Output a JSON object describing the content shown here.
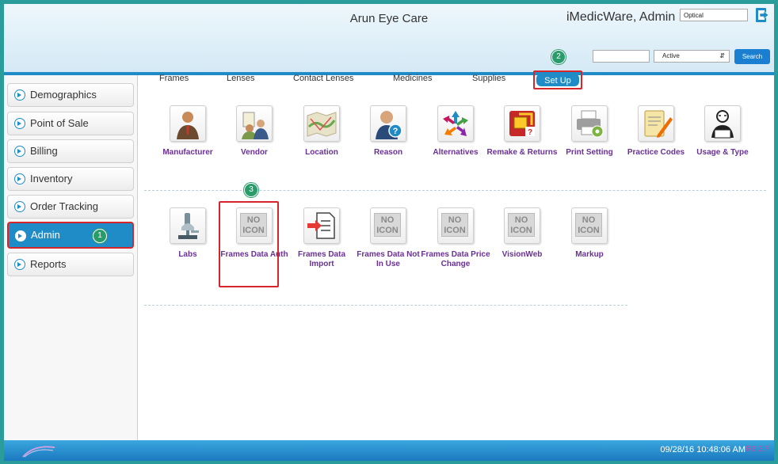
{
  "header": {
    "clinic": "Arun Eye Care",
    "user": "iMedicWare, Admin R",
    "department": "Optical",
    "status": "Active",
    "search_button": "Search"
  },
  "sidebar": {
    "items": [
      {
        "label": "Demographics"
      },
      {
        "label": "Point of Sale"
      },
      {
        "label": "Billing"
      },
      {
        "label": "Inventory"
      },
      {
        "label": "Order Tracking"
      },
      {
        "label": "Admin"
      },
      {
        "label": "Reports"
      }
    ]
  },
  "top_nav": [
    "Frames",
    "Lenses",
    "Contact Lenses",
    "Medicines",
    "Supplies",
    "Set Up"
  ],
  "badges": [
    "1",
    "2",
    "3"
  ],
  "row1": [
    {
      "label": "Manufacturer"
    },
    {
      "label": "Vendor"
    },
    {
      "label": "Location"
    },
    {
      "label": "Reason"
    },
    {
      "label": "Alternatives"
    },
    {
      "label": "Remake & Returns"
    },
    {
      "label": "Print Setting"
    },
    {
      "label": "Practice Codes"
    },
    {
      "label": "Usage & Type"
    }
  ],
  "row2": [
    {
      "label": "Labs",
      "noicon": ""
    },
    {
      "label": "Frames Data Auth",
      "noicon": "NO ICON"
    },
    {
      "label": "Frames Data Import",
      "noicon": ""
    },
    {
      "label": "Frames Data Not In Use",
      "noicon": "NO ICON"
    },
    {
      "label": "Frames Data Price Change",
      "noicon": "NO ICON"
    },
    {
      "label": "VisionWeb",
      "noicon": "NO ICON"
    },
    {
      "label": "Markup",
      "noicon": "NO ICON"
    }
  ],
  "footer": {
    "datetime": "09/28/16  10:48:06 AM",
    "version": "R6.3.7"
  },
  "colors": {
    "accent": "#1f8cc8",
    "highlight": "#d6262c",
    "tile_label": "#6a3096",
    "frame_border": "#2a9c9c"
  }
}
